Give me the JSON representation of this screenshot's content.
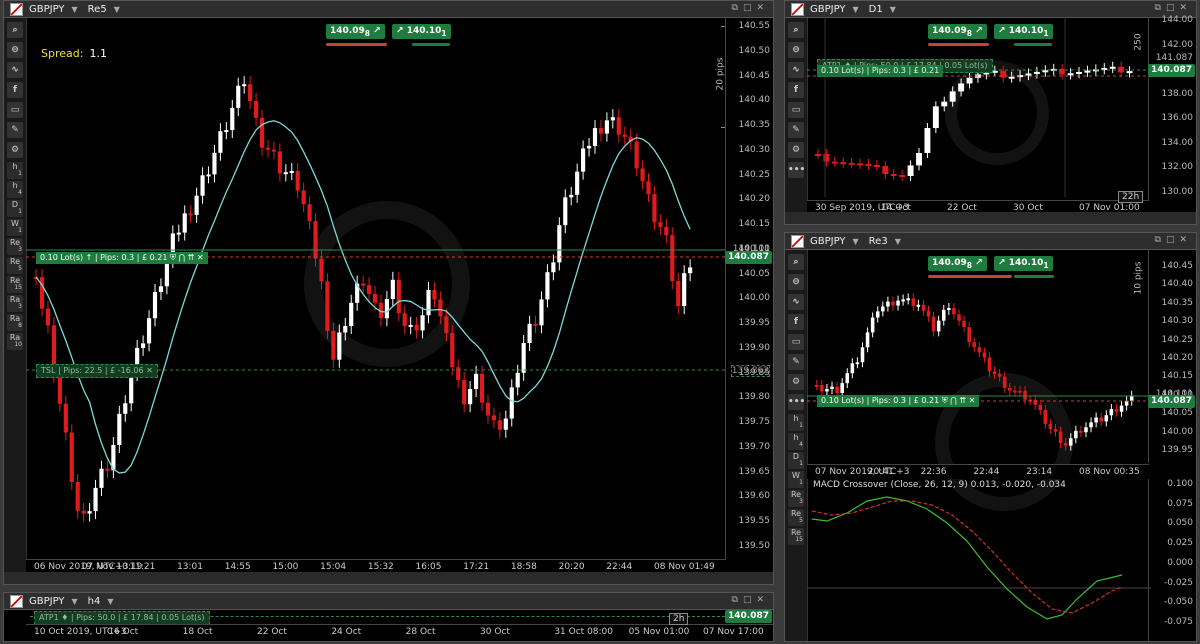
{
  "main": {
    "symbol": "GBPJPY",
    "timeframe": "Re5",
    "sell": "140.09",
    "sell_sup": "8",
    "buy": "140.10",
    "buy_sup": "1",
    "spread_label": "Spread:",
    "spread_value": "1.1",
    "pips_label": "20 pips",
    "position": "0.10 Lot(s) ↑ | Pips: 0.3 | £ 0.21",
    "tsl": "TSL  | Pips: 22.5 | £ -16.06",
    "price_tag": "140.087",
    "price_top": "140.101",
    "price_tsl": "139.862",
    "yticks": [
      "140.55",
      "140.50",
      "140.45",
      "140.40",
      "140.35",
      "140.30",
      "140.25",
      "140.20",
      "140.15",
      "140.10",
      "140.05",
      "140.00",
      "139.95",
      "139.90",
      "139.85",
      "139.80",
      "139.75",
      "139.70",
      "139.65",
      "139.60",
      "139.55",
      "139.50"
    ],
    "xticks": [
      "06 Nov 2019, UTC+3",
      "07 Nov 10:19",
      "11:21",
      "13:01",
      "14:55",
      "15:00",
      "15:04",
      "15:32",
      "16:05",
      "17:21",
      "18:58",
      "20:20",
      "22:44",
      "08 Nov 01:49"
    ],
    "cursor_label": "2h"
  },
  "d1": {
    "symbol": "GBPJPY",
    "timeframe": "D1",
    "sell": "140.09",
    "sell_sup": "8",
    "buy": "140.10",
    "buy_sup": "1",
    "pips_label": "250",
    "position": "0.10 Lot(s) | Pips: 0.3 | £ 0.21",
    "atp": "ATP1 ♦ | Pips: 50.0 | £ 17.84 | 0.05 Lot(s)",
    "price_tag": "140.087",
    "price_top": "141.087",
    "yticks": [
      "144.00",
      "142.00",
      "140.00",
      "138.00",
      "136.00",
      "134.00",
      "132.00",
      "130.00"
    ],
    "xticks": [
      "30 Sep 2019, UTC+3",
      "14 Oct",
      "22 Oct",
      "30 Oct",
      "07 Nov 01:00"
    ],
    "cursor_label": "22h"
  },
  "re3": {
    "symbol": "GBPJPY",
    "timeframe": "Re3",
    "sell": "140.09",
    "sell_sup": "8",
    "buy": "140.10",
    "buy_sup": "1",
    "pips_label": "10 pips",
    "position": "0.10 Lot(s) | Pips: 0.3 | £ 0.21",
    "price_tag": "140.087",
    "price_top": "140.101",
    "yticks": [
      "140.45",
      "140.40",
      "140.35",
      "140.30",
      "140.25",
      "140.20",
      "140.15",
      "140.10",
      "140.05",
      "140.00",
      "139.95"
    ],
    "xticks": [
      "07 Nov 2019, UTC+3",
      "20:41",
      "22:36",
      "22:44",
      "23:14",
      "08 Nov 00:35"
    ],
    "macd_title": "MACD Crossover (Close, 26, 12, 9) 0.013, -0.020, -0.034",
    "macd_ticks": [
      "0.100",
      "0.075",
      "0.050",
      "0.025",
      "0.000",
      "-0.025",
      "-0.050",
      "-0.075"
    ]
  },
  "h4": {
    "symbol": "GBPJPY",
    "timeframe": "h4",
    "atp": "ATP1 ♦ | Pips: 50.0 | £ 17.84 | 0.05 Lot(s)",
    "price_tag": "140.087",
    "xticks": [
      "10 Oct 2019, UTC+3",
      "16 Oct",
      "18 Oct",
      "22 Oct",
      "24 Oct",
      "28 Oct",
      "30 Oct",
      "31 Oct 08:00",
      "05 Nov 01:00",
      "07 Nov 17:00"
    ],
    "cursor_label": "2h"
  },
  "toolbar": {
    "icons": [
      "search-icon",
      "zoom-out-icon",
      "indicator-icon",
      "facebook-icon",
      "chart-type-icon",
      "draw-icon",
      "settings-icon"
    ],
    "timeframes": [
      {
        "a": "h",
        "b": "1"
      },
      {
        "a": "h",
        "b": "4"
      },
      {
        "a": "D",
        "b": "1"
      },
      {
        "a": "W",
        "b": "1"
      },
      {
        "a": "Re",
        "b": "3"
      },
      {
        "a": "Re",
        "b": "5"
      },
      {
        "a": "Re",
        "b": "15"
      },
      {
        "a": "Ra",
        "b": "3"
      },
      {
        "a": "Ra",
        "b": "8"
      },
      {
        "a": "Ra",
        "b": "10"
      }
    ],
    "timeframes_short": [
      {
        "a": "h",
        "b": "1"
      },
      {
        "a": "h",
        "b": "4"
      },
      {
        "a": "D",
        "b": "1"
      },
      {
        "a": "W",
        "b": "1"
      },
      {
        "a": "Re",
        "b": "3"
      },
      {
        "a": "Re",
        "b": "5"
      },
      {
        "a": "Re",
        "b": "15"
      }
    ],
    "more": "•••"
  },
  "colors": {
    "up": "#ffffff",
    "down": "#e01b1b",
    "ma": "#7fd8d8",
    "accent": "#1e7d3e",
    "macd": "#3fbf2f",
    "signal": "#d03030"
  }
}
